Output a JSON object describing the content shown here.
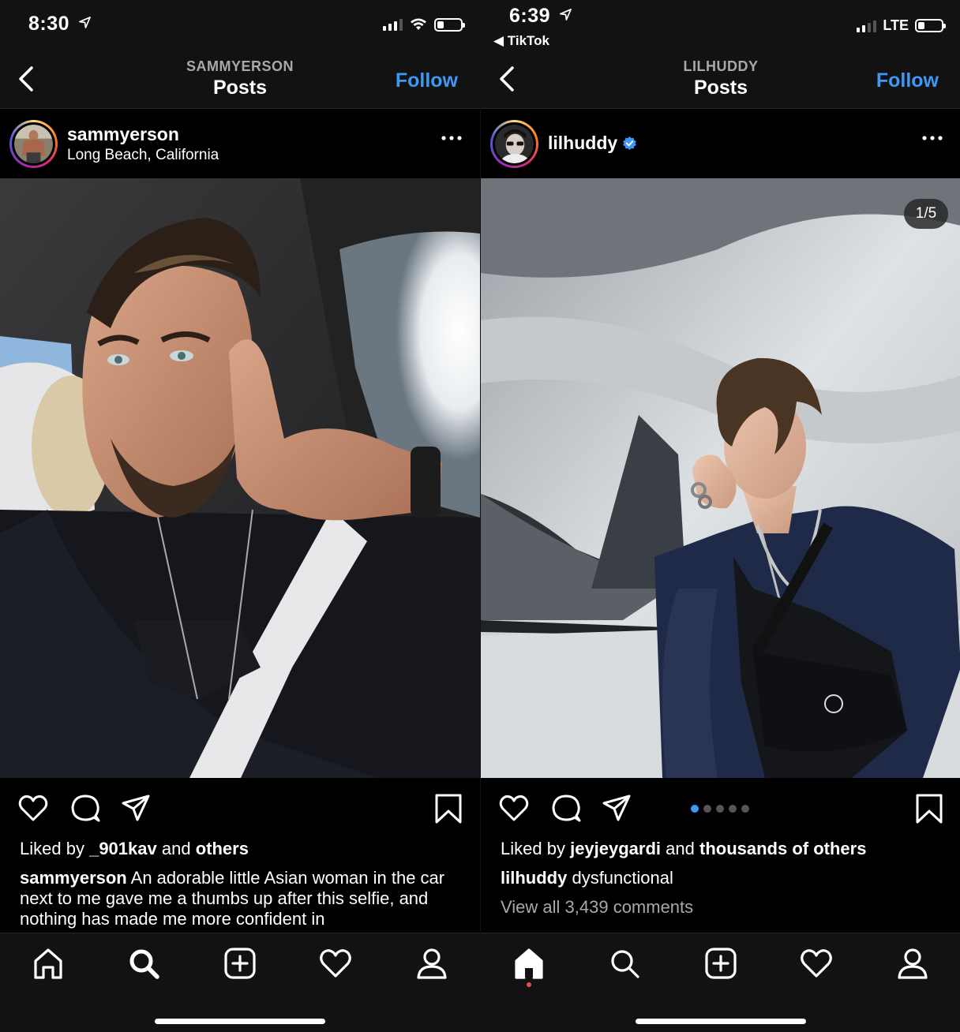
{
  "left": {
    "status": {
      "time": "8:30"
    },
    "header": {
      "username_upper": "SAMMYERSON",
      "title": "Posts",
      "follow": "Follow"
    },
    "post": {
      "username": "sammyerson",
      "location": "Long Beach, California",
      "liked_by_prefix": "Liked by",
      "liked_by_user": "_901kav",
      "liked_by_and": "and",
      "liked_by_others": "others",
      "caption_user": "sammyerson",
      "caption_text": "An adorable little Asian woman in the car next to me gave me a thumbs up after this selfie, and nothing has made me more confident in"
    },
    "icons": {
      "back": "chevron-left-icon",
      "more": "more-dots-icon",
      "like": "heart-icon",
      "comment": "comment-icon",
      "share": "send-icon",
      "save": "bookmark-icon"
    },
    "tabbar": {
      "active": "search",
      "items": [
        "home",
        "search",
        "new-post",
        "activity",
        "profile"
      ]
    }
  },
  "right": {
    "status": {
      "time": "6:39",
      "back_app": "◀ TikTok",
      "network": "LTE"
    },
    "header": {
      "username_upper": "LILHUDDY",
      "title": "Posts",
      "follow": "Follow"
    },
    "post": {
      "username": "lilhuddy",
      "verified": true,
      "carousel_counter": "1/5",
      "carousel_total": 5,
      "carousel_index": 1,
      "liked_by_prefix": "Liked by",
      "liked_by_user": "jeyjeygardi",
      "liked_by_and": "and",
      "liked_by_others": "thousands of others",
      "caption_user": "lilhuddy",
      "caption_text": "dysfunctional",
      "view_all": "View all 3,439 comments"
    },
    "tabbar": {
      "active": "home",
      "items": [
        "home",
        "search",
        "new-post",
        "activity",
        "profile"
      ]
    }
  },
  "colors": {
    "accent": "#3d99f5",
    "background": "#000000",
    "bar": "#121212",
    "muted": "#a8a8a8",
    "notification": "#ed4956"
  }
}
